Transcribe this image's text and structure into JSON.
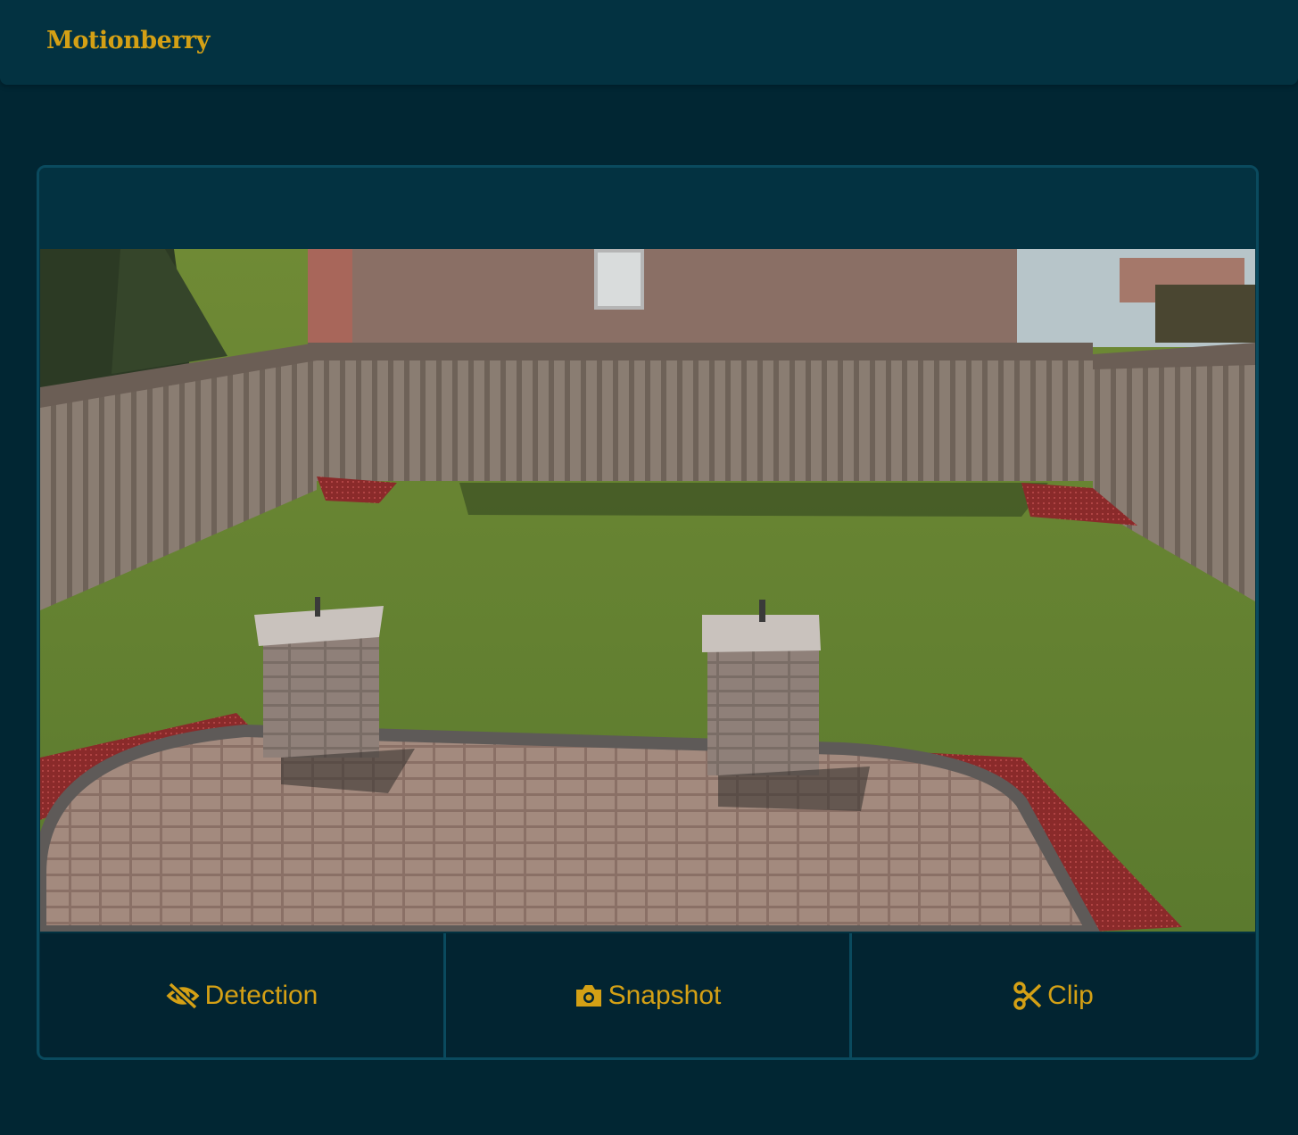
{
  "app": {
    "brand": "Motionberry"
  },
  "camera": {
    "stream_alt": "Live camera stream",
    "header_title": ""
  },
  "actions": [
    {
      "label": "Detection",
      "icon": "eye-slash-icon"
    },
    {
      "label": "Snapshot",
      "icon": "camera-icon"
    },
    {
      "label": "Clip",
      "icon": "scissors-icon"
    }
  ],
  "colors": {
    "background": "#012633",
    "surface": "#033241",
    "accent": "#d4a015",
    "border": "#0a4a5e"
  }
}
